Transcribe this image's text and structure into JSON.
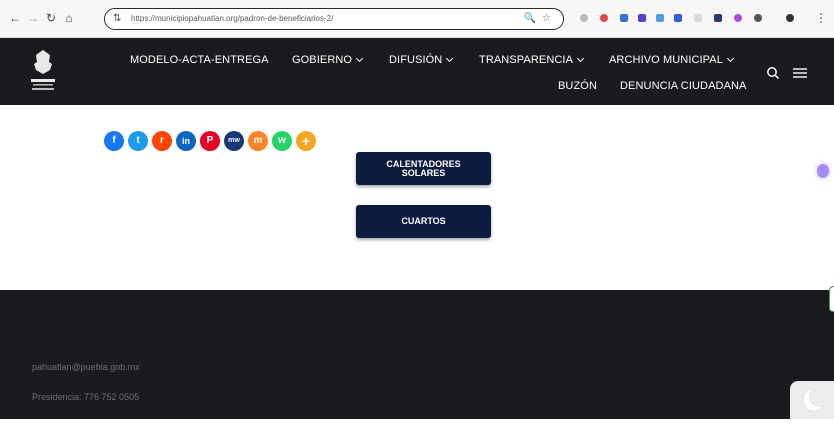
{
  "browser": {
    "url": "https://municipiopahuatlan.org/padron-de-beneficiarios-2/",
    "back_icon": "arrow-left-icon",
    "forward_icon": "arrow-right-icon",
    "reload_icon": "reload-icon",
    "home_icon": "home-icon"
  },
  "header": {
    "logo_icon": "municipal-shield-logo",
    "nav": [
      {
        "label": "MODELO-ACTA-ENTREGA",
        "has_dropdown": false
      },
      {
        "label": "GOBIERNO",
        "has_dropdown": true
      },
      {
        "label": "DIFUSIÓN",
        "has_dropdown": true
      },
      {
        "label": "TRANSPARENCIA",
        "has_dropdown": true
      },
      {
        "label": "ARCHIVO MUNICIPAL",
        "has_dropdown": true
      },
      {
        "label": "BUZÓN",
        "has_dropdown": false
      },
      {
        "label": "DENUNCIA CIUDADANA",
        "has_dropdown": false
      }
    ],
    "search_icon": "search-icon",
    "menu_icon": "hamburger-icon"
  },
  "share": {
    "icons": [
      {
        "name": "facebook",
        "color": "#1877f2",
        "glyph": "f"
      },
      {
        "name": "twitter",
        "color": "#1d9bf0",
        "glyph": "t"
      },
      {
        "name": "reddit",
        "color": "#ff4500",
        "glyph": "r"
      },
      {
        "name": "linkedin",
        "color": "#0a66c2",
        "glyph": "in"
      },
      {
        "name": "pinterest",
        "color": "#e60023",
        "glyph": "P"
      },
      {
        "name": "mewe",
        "color": "#17377a",
        "glyph": "mw"
      },
      {
        "name": "mix",
        "color": "#ff8226",
        "glyph": "m"
      },
      {
        "name": "whatsapp",
        "color": "#25d366",
        "glyph": "w"
      },
      {
        "name": "more",
        "color": "#f5a623",
        "glyph": "+"
      }
    ]
  },
  "main": {
    "button_calentadores_line1": "CALENTADORES",
    "button_calentadores_line2": "SOLARES",
    "button_cuartos": "CUARTOS"
  },
  "footer": {
    "email": "pahuatlan@puebla.gob.mx",
    "phone": "Presidencia: 776 752 0505"
  },
  "colors": {
    "header_bg": "#1b1b1f",
    "button_bg": "#0c1b3e",
    "footer_bg": "#1b1b1f"
  }
}
